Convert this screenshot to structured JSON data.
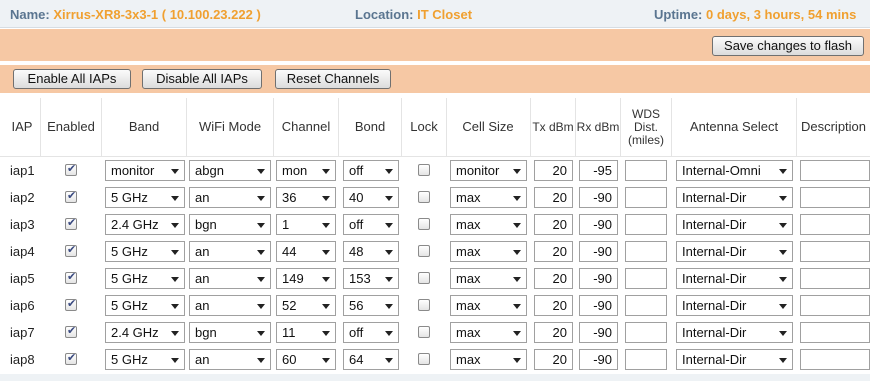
{
  "status": {
    "name_label": "Name:",
    "name_value": "Xirrus-XR8-3x3-1   ( 10.100.23.222 )",
    "location_label": "Location:",
    "location_value": "IT Closet",
    "uptime_label": "Uptime:",
    "uptime_value": "0 days, 3 hours, 54 mins"
  },
  "toolbar": {
    "save_label": "Save changes to flash",
    "enable_all_label": "Enable All IAPs",
    "disable_all_label": "Disable All IAPs",
    "reset_channels_label": "Reset Channels"
  },
  "table": {
    "headers": {
      "iap": "IAP",
      "enabled": "Enabled",
      "band": "Band",
      "wifi_mode": "WiFi Mode",
      "channel": "Channel",
      "bond": "Bond",
      "lock": "Lock",
      "cell_size": "Cell Size",
      "tx": "Tx dBm",
      "rx": "Rx dBm",
      "wds": "WDS Dist. (miles)",
      "antenna": "Antenna Select",
      "description": "Description"
    },
    "rows": [
      {
        "iap": "iap1",
        "enabled": true,
        "band": "monitor",
        "mode": "abgn",
        "channel": "mon",
        "bond": "off",
        "lock": false,
        "cell": "monitor",
        "tx": "20",
        "rx": "-95",
        "wds": "",
        "antenna": "Internal-Omni",
        "description": ""
      },
      {
        "iap": "iap2",
        "enabled": true,
        "band": "5 GHz",
        "mode": "an",
        "channel": "36",
        "bond": "40",
        "lock": false,
        "cell": "max",
        "tx": "20",
        "rx": "-90",
        "wds": "",
        "antenna": "Internal-Dir",
        "description": ""
      },
      {
        "iap": "iap3",
        "enabled": true,
        "band": "2.4 GHz",
        "mode": "bgn",
        "channel": "1",
        "bond": "off",
        "lock": false,
        "cell": "max",
        "tx": "20",
        "rx": "-90",
        "wds": "",
        "antenna": "Internal-Dir",
        "description": ""
      },
      {
        "iap": "iap4",
        "enabled": true,
        "band": "5 GHz",
        "mode": "an",
        "channel": "44",
        "bond": "48",
        "lock": false,
        "cell": "max",
        "tx": "20",
        "rx": "-90",
        "wds": "",
        "antenna": "Internal-Dir",
        "description": ""
      },
      {
        "iap": "iap5",
        "enabled": true,
        "band": "5 GHz",
        "mode": "an",
        "channel": "149",
        "bond": "153",
        "lock": false,
        "cell": "max",
        "tx": "20",
        "rx": "-90",
        "wds": "",
        "antenna": "Internal-Dir",
        "description": ""
      },
      {
        "iap": "iap6",
        "enabled": true,
        "band": "5 GHz",
        "mode": "an",
        "channel": "52",
        "bond": "56",
        "lock": false,
        "cell": "max",
        "tx": "20",
        "rx": "-90",
        "wds": "",
        "antenna": "Internal-Dir",
        "description": ""
      },
      {
        "iap": "iap7",
        "enabled": true,
        "band": "2.4 GHz",
        "mode": "bgn",
        "channel": "11",
        "bond": "off",
        "lock": false,
        "cell": "max",
        "tx": "20",
        "rx": "-90",
        "wds": "",
        "antenna": "Internal-Dir",
        "description": ""
      },
      {
        "iap": "iap8",
        "enabled": true,
        "band": "5 GHz",
        "mode": "an",
        "channel": "60",
        "bond": "64",
        "lock": false,
        "cell": "max",
        "tx": "20",
        "rx": "-90",
        "wds": "",
        "antenna": "Internal-Dir",
        "description": ""
      }
    ]
  },
  "colors": {
    "accent_orange": "#f0a030",
    "band_peach": "#f6c8a4",
    "label_blue": "#5a7590"
  }
}
